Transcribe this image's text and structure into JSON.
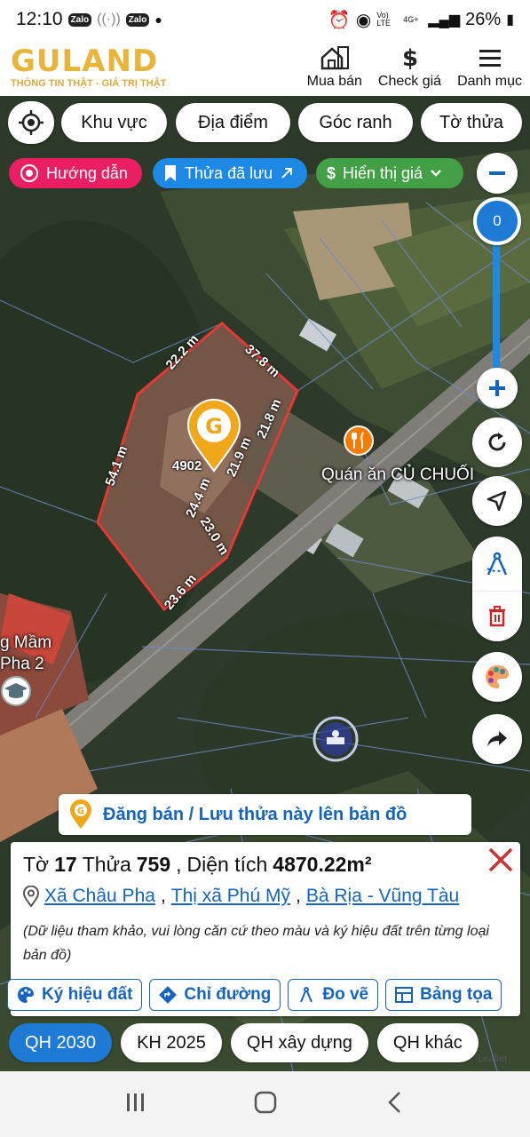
{
  "status": {
    "time": "12:10",
    "battery": "26%",
    "net": "4G+",
    "volte": "Vo) LTE",
    "zalo": "Zalo"
  },
  "header": {
    "logo": "GULAND",
    "tagline": "THÔNG TIN THẬT - GIÁ TRỊ THẬT",
    "nav": [
      {
        "label": "Mua bán",
        "icon": "house-icon"
      },
      {
        "label": "Check giá",
        "icon": "dollar-icon"
      },
      {
        "label": "Danh mục",
        "icon": "menu-icon"
      }
    ]
  },
  "filters": [
    "Khu vực",
    "Địa điểm",
    "Góc ranh",
    "Tờ thửa"
  ],
  "chips": {
    "guide": "Hướng dẫn",
    "saved": "Thửa đã lưu",
    "price": "Hiển thị giá"
  },
  "zoom": {
    "value": "0"
  },
  "map": {
    "dimensions": [
      "22.2 m",
      "37.8 m",
      "21.8 m",
      "21.9 m",
      "54.1 m",
      "24.4 m",
      "23.0 m",
      "23.6 m"
    ],
    "area_label": "4902",
    "restaurant": "Quán ăn CỦ CHUỐI",
    "school": "g Mầm\nPha 2"
  },
  "post_banner": "Đăng bán / Lưu thửa này lên bản đồ",
  "parcel": {
    "to_label": "Tờ",
    "to": "17",
    "thua_label": "Thửa",
    "thua": "759",
    "area_label": "Diện tích",
    "area": "4870.22m²",
    "ward": "Xã Châu Pha",
    "district": "Thị xã Phú Mỹ",
    "province": "Bà Rịa - Vũng Tàu",
    "note": "(Dữ liệu tham khảo, vui lòng căn cứ theo màu và ký hiệu đất trên từng loại bản đồ)"
  },
  "actions": [
    "Ký hiệu đất",
    "Chỉ đường",
    "Đo vẽ",
    "Bảng tọa"
  ],
  "layers": [
    "QH 2030",
    "KH 2025",
    "QH xây dựng",
    "QH khác"
  ],
  "leaflet": "Leaflet",
  "colors": {
    "accent": "#1e7ad4",
    "link": "#1565c0",
    "parcel": "#e53935",
    "guide": "#e91e63",
    "saved": "#1e88e5",
    "price": "#43a047",
    "logo": "#e8b53a"
  }
}
